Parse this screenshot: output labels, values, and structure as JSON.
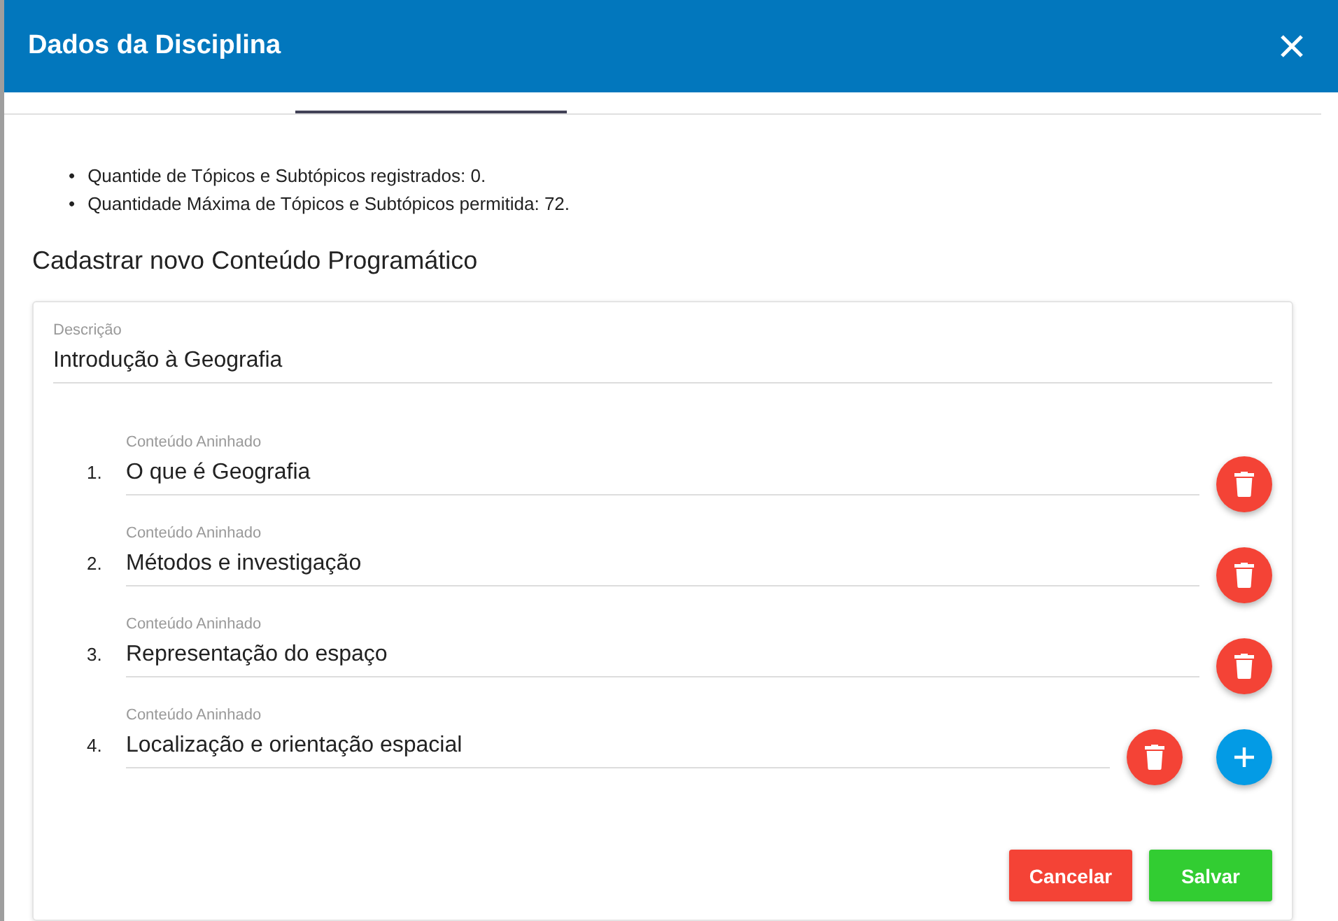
{
  "dialog": {
    "title": "Dados da Disciplina"
  },
  "tabs": [
    {
      "selected": false
    },
    {
      "selected": true
    },
    {
      "selected": false
    },
    {
      "selected": false
    }
  ],
  "info": [
    {
      "marker": "•",
      "text": "Quantide de Tópicos e Subtópicos registrados: 0."
    },
    {
      "marker": "•",
      "text": "Quantidade Máxima de Tópicos e Subtópicos permitida: 72."
    }
  ],
  "section_title": "Cadastrar novo Conteúdo Programático",
  "description": {
    "label": "Descrição",
    "value": "Introdução à Geografia"
  },
  "items": [
    {
      "number": "1.",
      "label": "Conteúdo Aninhado",
      "value": "O que é Geografia",
      "can_add": false
    },
    {
      "number": "2.",
      "label": "Conteúdo Aninhado",
      "value": "Métodos e investigação",
      "can_add": false
    },
    {
      "number": "3.",
      "label": "Conteúdo Aninhado",
      "value": "Representação do espaço",
      "can_add": false
    },
    {
      "number": "4.",
      "label": "Conteúdo Aninhado",
      "value": "Localização e orientação espacial",
      "can_add": true
    }
  ],
  "buttons": [
    {
      "label": "Cancelar",
      "kind": "cancel"
    },
    {
      "label": "Salvar",
      "kind": "save"
    }
  ]
}
